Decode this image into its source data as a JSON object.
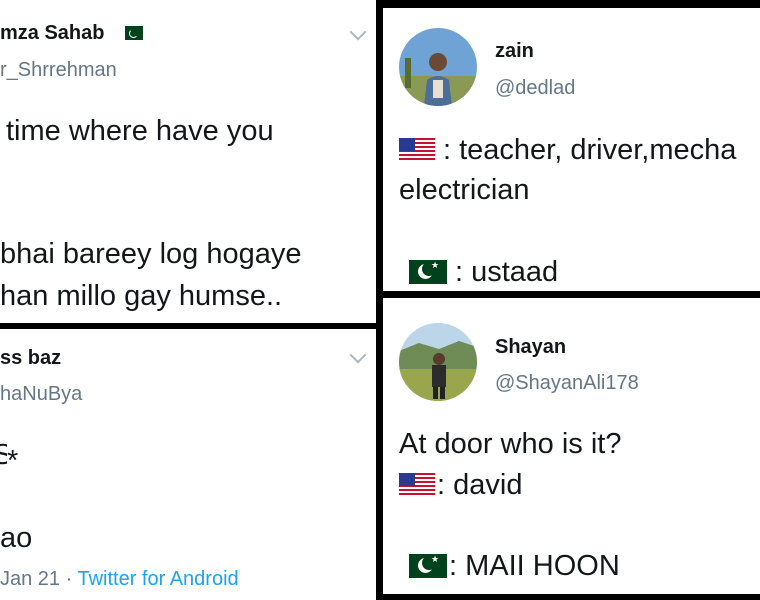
{
  "tweet1": {
    "name": "mza Sahab",
    "handle": "r_Shrrehman",
    "line1": "time where have you",
    "line2": "bhai bareey log hogaye",
    "line3": "han millo gay humse.."
  },
  "tweet2": {
    "name": "ss baz",
    "handle": "haNuBya",
    "line1": "*",
    "line2": "ao",
    "date": "Jan 21 · ",
    "source": "Twitter for Android"
  },
  "tweet3": {
    "name": "zain",
    "handle": "@dedlad",
    "line1": ": teacher, driver,mecha",
    "line2": "electrician",
    "line3": ": ustaad"
  },
  "tweet4": {
    "name": "Shayan",
    "handle": "@ShayanAli178",
    "line1": "At door who is it?",
    "line2": ": david",
    "line3": ": MAII HOON"
  },
  "icons": {
    "pk_flag": "pakistan-flag-icon",
    "us_flag": "usa-flag-icon",
    "chevron": "chevron-down-icon"
  }
}
